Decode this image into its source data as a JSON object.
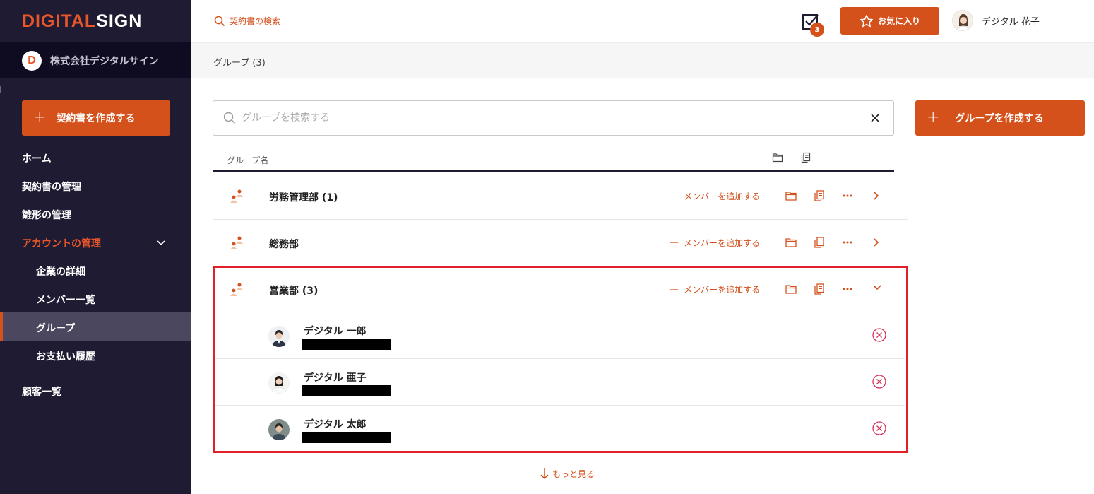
{
  "brand": {
    "part1": "DIGITAL",
    "part2": "SIGN"
  },
  "company": {
    "badge": "D",
    "name": "株式会社デジタルサイン"
  },
  "sidebar": {
    "create_label": "契約書を作成する",
    "items": [
      {
        "label": "ホーム"
      },
      {
        "label": "契約書の管理"
      },
      {
        "label": "雛形の管理"
      },
      {
        "label": "アカウントの管理"
      },
      {
        "label": "企業の詳細"
      },
      {
        "label": "メンバー一覧"
      },
      {
        "label": "グループ"
      },
      {
        "label": "お支払い履歴"
      },
      {
        "label": "顧客一覧"
      }
    ]
  },
  "header": {
    "search_label": "契約書の検索",
    "task_count": "3",
    "favorite_label": "お気に入り",
    "user_name": "デジタル 花子"
  },
  "breadcrumb": "グループ (3)",
  "search": {
    "placeholder": "グループを検索する"
  },
  "create_group_label": "グループを作成する",
  "table": {
    "col_name": "グループ名"
  },
  "add_member_label": "メンバーを追加する",
  "groups": [
    {
      "name": "労務管理部 (1)"
    },
    {
      "name": "総務部"
    },
    {
      "name": "営業部 (3)"
    }
  ],
  "members": [
    {
      "name": "デジタル 一郎"
    },
    {
      "name": "デジタル 亜子"
    },
    {
      "name": "デジタル 太郎"
    }
  ],
  "more_label": "もっと見る",
  "colors": {
    "accent": "#d4511c",
    "sidebar": "#1f1b33",
    "highlight": "#e0202a"
  }
}
